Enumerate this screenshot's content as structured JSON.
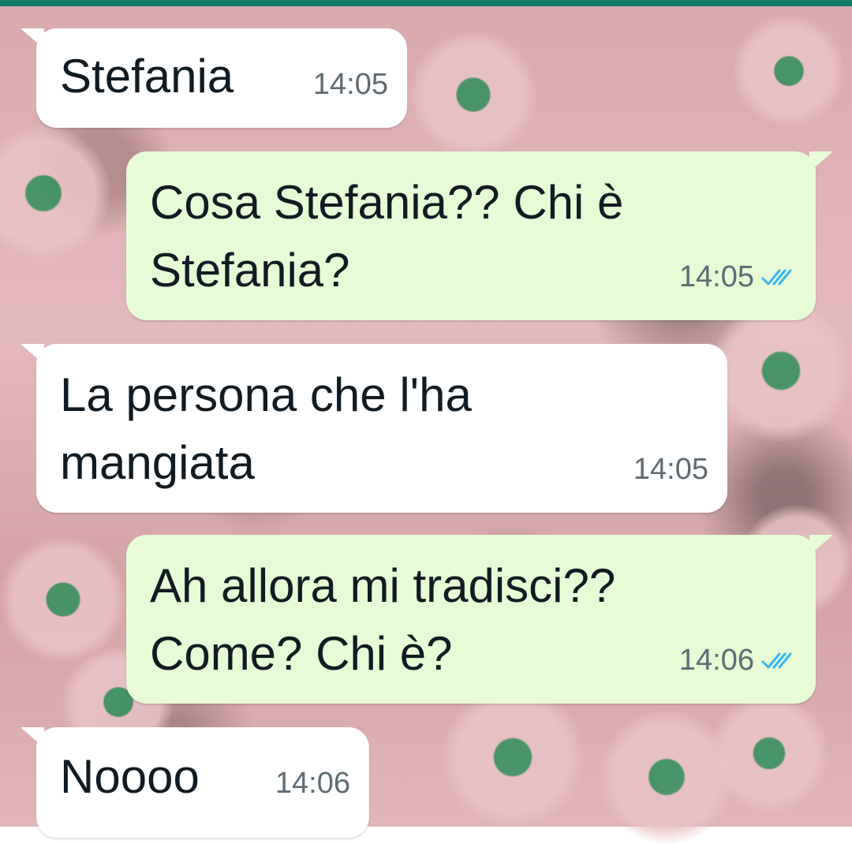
{
  "chat": {
    "messages": [
      {
        "direction": "incoming",
        "text": "Stefania",
        "time": "14:05"
      },
      {
        "direction": "outgoing",
        "text": "Cosa Stefania?? Chi è\nStefania?",
        "time": "14:05",
        "status_icon": "double-check-icon",
        "status_color": "#34b7f1"
      },
      {
        "direction": "incoming",
        "text": "La persona che l'ha\nmangiata",
        "time": "14:05"
      },
      {
        "direction": "outgoing",
        "text": "Ah allora mi tradisci??\nCome? Chi è?",
        "time": "14:06",
        "status_icon": "double-check-icon",
        "status_color": "#34b7f1"
      },
      {
        "direction": "incoming",
        "text": "Noooo",
        "time": "14:06"
      }
    ]
  },
  "colors": {
    "incoming_bubble": "#ffffff",
    "outgoing_bubble": "#e7fbd6",
    "top_bar": "#0f7a66",
    "read_check": "#34b7f1"
  }
}
